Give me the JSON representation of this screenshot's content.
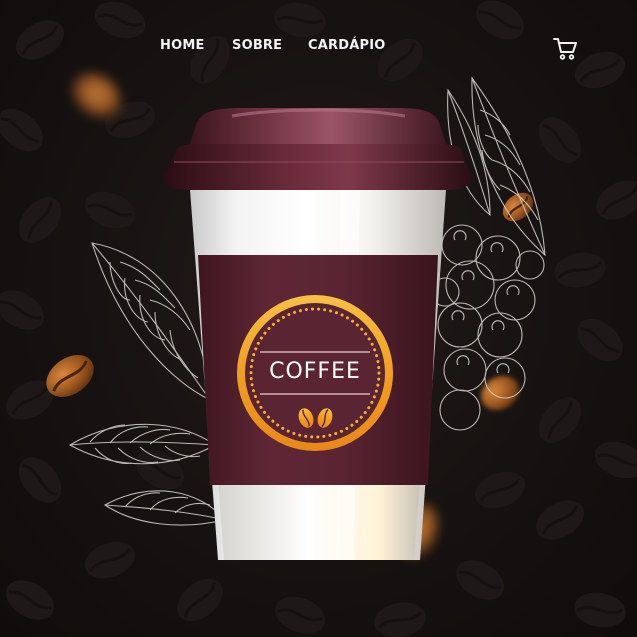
{
  "nav": {
    "items": [
      {
        "label": "HOME"
      },
      {
        "label": "SOBRE"
      },
      {
        "label": "CARDÁPIO"
      }
    ]
  },
  "cart": {
    "icon": "cart-icon"
  },
  "cup": {
    "label_text": "COFFEE",
    "lid_color": "#5a2431",
    "sleeve_color": "#5b2432",
    "badge_gold": "#f0a020"
  },
  "colors": {
    "background": "#141110",
    "nav_text": "#f2f2f2"
  }
}
